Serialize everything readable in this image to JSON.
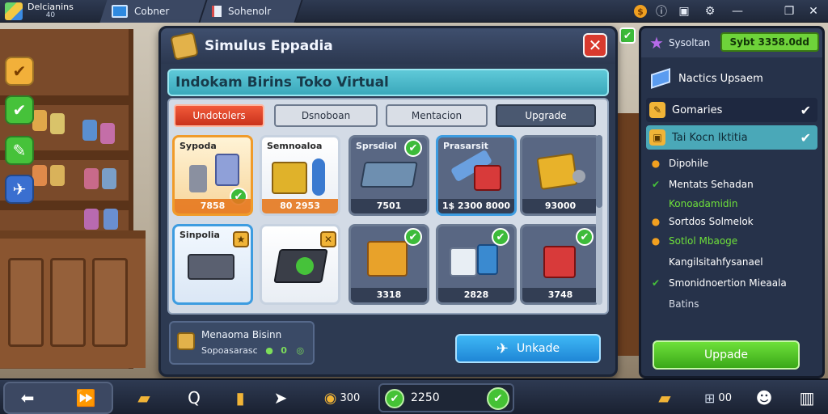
{
  "topbar": {
    "app_name": "Delcianins",
    "app_version": "40",
    "tab1": "Cobner",
    "tab2": "Sohenolr"
  },
  "dialog": {
    "title": "Simulus Eppadia",
    "close_symbol": "✕",
    "banner": "Indokam Birins Toko Virtual",
    "tabs": [
      "Undotolers",
      "Dsnoboan",
      "Mentacion",
      "Upgrade"
    ],
    "cards": [
      {
        "title": "Sypoda",
        "price": "7858",
        "checked": true
      },
      {
        "title": "Semnoaloa",
        "price": "80  2953",
        "checked": false
      },
      {
        "title": "Sprsdiol",
        "price": "7501",
        "checked": true
      },
      {
        "title": "Prasarsit",
        "price": "1$ 2300 8000",
        "checked": false
      },
      {
        "title": "",
        "price": "93000",
        "checked": false
      },
      {
        "title": "Sinpolia",
        "price": "",
        "checked": false
      },
      {
        "title": "",
        "price": "",
        "checked": false
      },
      {
        "title": "",
        "price": "3318",
        "checked": true
      },
      {
        "title": "",
        "price": "2828",
        "checked": true
      },
      {
        "title": "",
        "price": "3748",
        "checked": true
      }
    ],
    "footer": {
      "line1": "Menaoma Bisinn",
      "line2_label": "Sopoasarasc",
      "line2_value": "0"
    },
    "upgrade_label": "Unkade"
  },
  "right_panel": {
    "system_label": "Sysoltan",
    "money": "Sybt 3358.0dd",
    "subtitle": "Nactics Upsaem",
    "rows": [
      {
        "label": "Gomaries",
        "checked": true
      },
      {
        "label": "Tai Kocn Iktitia",
        "checked": true
      }
    ],
    "lines": [
      {
        "label": "Dipohile",
        "marker": "coin",
        "color": "#ffffff"
      },
      {
        "label": "Mentats Sehadan",
        "marker": "check",
        "color": "#ffffff"
      },
      {
        "label": "Konoadamidin",
        "marker": "none",
        "color": "#6ee03a"
      },
      {
        "label": "Sortdos Solmelok",
        "marker": "coin",
        "color": "#ffffff"
      },
      {
        "label": "Sotlol Mbaoge",
        "marker": "coin",
        "color": "#6ee03a"
      },
      {
        "label": "Kangilsitahfysanael",
        "marker": "none",
        "color": "#ffffff"
      },
      {
        "label": "Smonidnoertion Mieaala",
        "marker": "check",
        "color": "#ffffff"
      },
      {
        "label": "Batins",
        "marker": "none",
        "color": "#d6dbe6"
      }
    ],
    "upgrade_label": "Uppade"
  },
  "bottom": {
    "count_value": "2250",
    "coins_label": "300",
    "bag_label": "00"
  },
  "colors": {
    "accent_red": "#d83a2e",
    "accent_green": "#3dbb3a",
    "accent_blue": "#1f86d6",
    "banner_teal": "#3aa8bb"
  }
}
